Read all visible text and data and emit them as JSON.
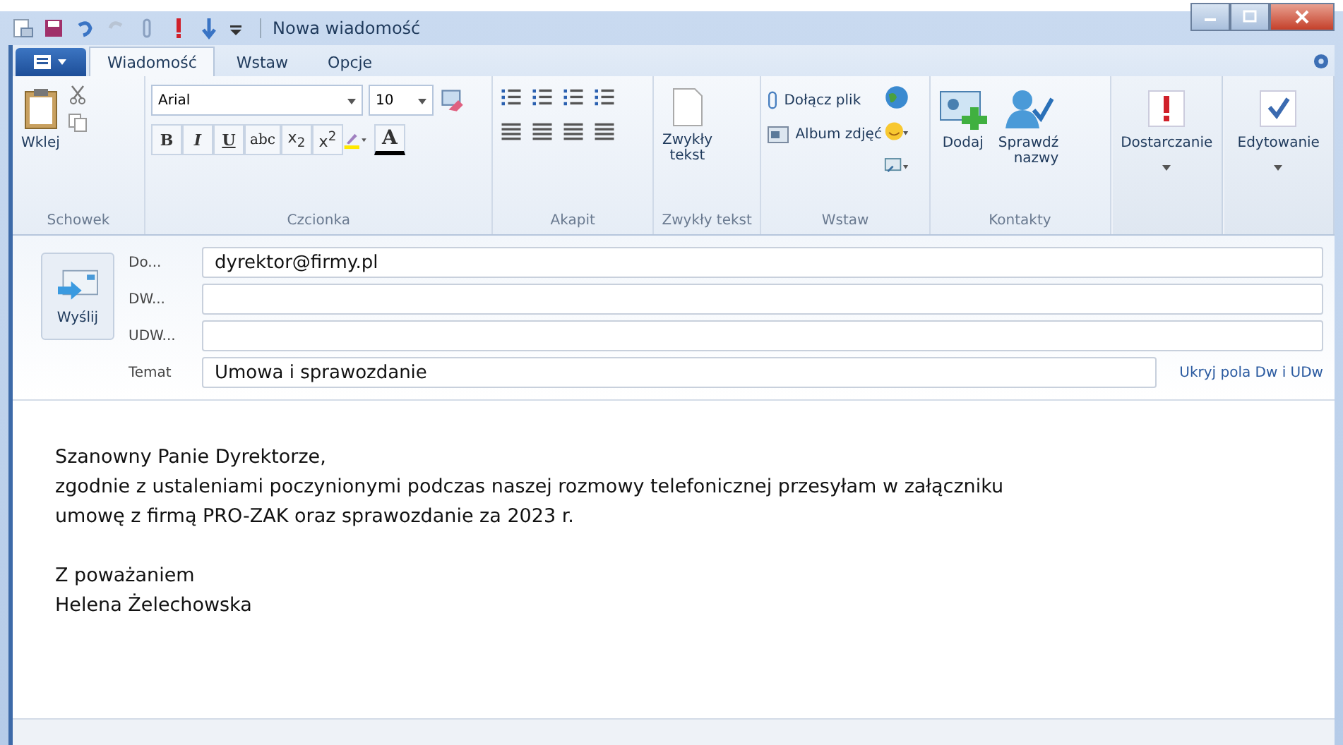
{
  "window": {
    "title": "Nowa wiadomość"
  },
  "tabs": [
    {
      "label": "Wiadomość",
      "selected": true
    },
    {
      "label": "Wstaw",
      "selected": false
    },
    {
      "label": "Opcje",
      "selected": false
    }
  ],
  "ribbon": {
    "clipboard": {
      "paste": "Wklej",
      "label": "Schowek"
    },
    "font": {
      "family": "Arial",
      "size": "10",
      "formats": [
        "B",
        "I",
        "U",
        "abc",
        "x$_{2}$",
        "x$^{2}$"
      ],
      "color_letter": "A",
      "label": "Czcionka"
    },
    "paragraph": {
      "label": "Akapit"
    },
    "plain_text": {
      "button": [
        "Zwykły",
        "tekst"
      ],
      "label": "Zwykły tekst"
    },
    "insert": {
      "attach": "Dołącz plik",
      "album": "Album zdjęć",
      "label": "Wstaw"
    },
    "contacts": {
      "add": "Dodaj",
      "check": [
        "Sprawdź",
        "nazwy"
      ],
      "label": "Kontakty"
    },
    "delivery": {
      "button": "Dostarczanie"
    },
    "editing": {
      "button": "Edytowanie"
    }
  },
  "header": {
    "send": "Wyślij",
    "recipients": [
      {
        "label": "Do...",
        "value": "dyrektor@firmy.pl"
      },
      {
        "label": "DW..."
      },
      {
        "label": "UDW..."
      }
    ],
    "subject": {
      "label": "Temat",
      "value": "Umowa i sprawozdanie"
    },
    "toggle_link": "Ukryj pola Dw i UDw"
  },
  "body": [
    [
      "Szanowny Panie Dyrektorze,",
      "zgodnie z ustaleniami poczynionymi podczas naszej rozmowy telefonicznej przesyłam w załączniku",
      "umowę z firmą PRO-ZAK oraz sprawozdanie za 2023 r."
    ],
    [
      "Z poważaniem",
      "Helena Żelechowska"
    ]
  ]
}
